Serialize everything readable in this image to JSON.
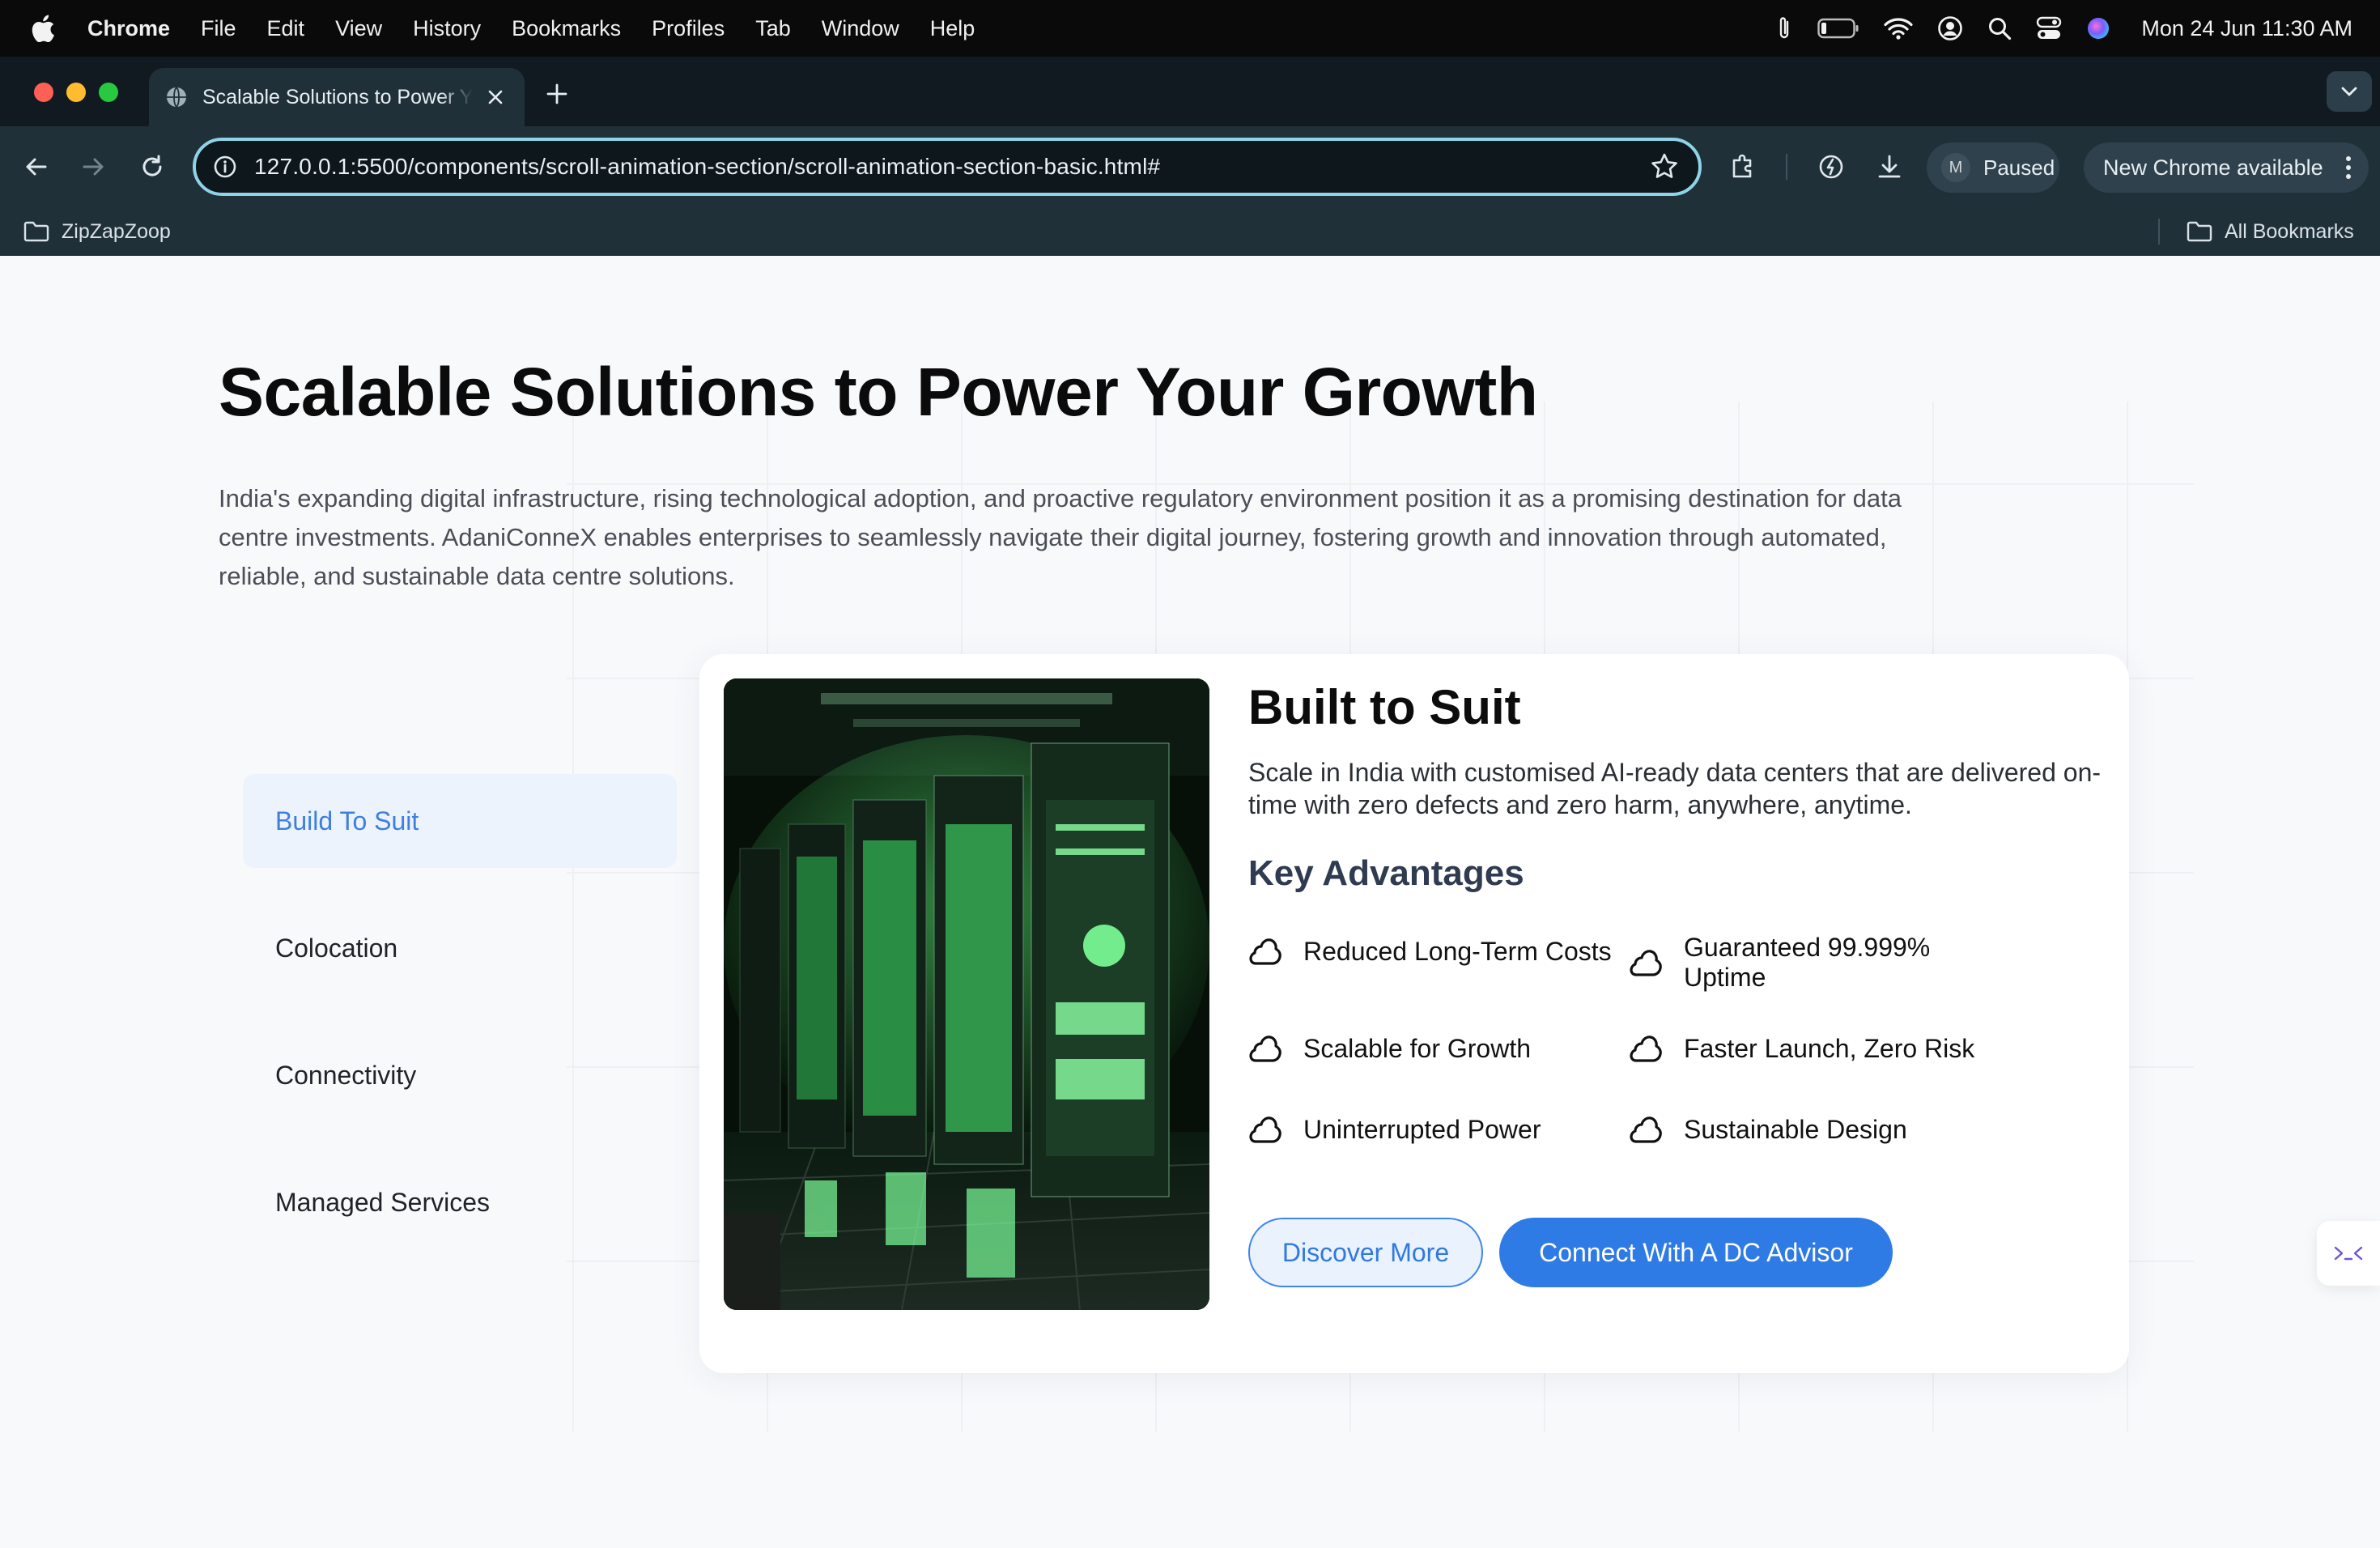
{
  "menubar": {
    "app_name": "Chrome",
    "items": [
      "File",
      "Edit",
      "View",
      "History",
      "Bookmarks",
      "Profiles",
      "Tab",
      "Window",
      "Help"
    ],
    "clock": "Mon 24 Jun  11:30 AM"
  },
  "browser": {
    "tab_title": "Scalable Solutions to Power Your Growth",
    "url": "127.0.0.1:5500/components/scroll-animation-section/scroll-animation-section-basic.html#",
    "profile_initial": "M",
    "profile_status": "Paused",
    "update_label": "New Chrome available",
    "bookmark_folder": "ZipZapZoop",
    "all_bookmarks": "All Bookmarks"
  },
  "page": {
    "headline": "Scalable Solutions to Power Your Growth",
    "intro": "India's expanding digital infrastructure, rising technological adoption, and proactive regulatory environment position it as a promising destination for data centre investments. AdaniConneX enables enterprises to seamlessly navigate their digital journey, fostering growth and innovation through automated, reliable, and sustainable data centre solutions.",
    "nav": [
      "Build To Suit",
      "Colocation",
      "Connectivity",
      "Managed Services"
    ],
    "active_nav_index": 0,
    "card": {
      "title": "Built to Suit",
      "description": "Scale in India with customised AI-ready data centers that are delivered on-time with zero defects and zero harm, anywhere, anytime.",
      "advantages_heading": "Key Advantages",
      "advantages": [
        "Reduced Long-Term Costs",
        "Guaranteed 99.999% Uptime",
        "Scalable for Growth",
        "Faster Launch, Zero Risk",
        "Uninterrupted Power",
        "Sustainable Design"
      ],
      "primary_button": "Connect With A DC Advisor",
      "secondary_button": "Discover More"
    }
  },
  "colors": {
    "accent": "#2f7be6",
    "active_nav_bg": "#edf3fc",
    "active_nav_text": "#3d7fe0",
    "browser_bg": "#203039"
  },
  "icons": [
    "apple-icon",
    "attachment-icon",
    "battery-icon",
    "wifi-icon",
    "user-circle-icon",
    "search-icon",
    "control-center-icon",
    "siri-icon",
    "globe-icon",
    "close-icon",
    "plus-icon",
    "chevron-down-icon",
    "back-arrow-icon",
    "forward-arrow-icon",
    "reload-icon",
    "info-icon",
    "star-icon",
    "extensions-icon",
    "performance-icon",
    "download-icon",
    "more-vertical-icon",
    "folder-icon",
    "cloud-icon"
  ]
}
